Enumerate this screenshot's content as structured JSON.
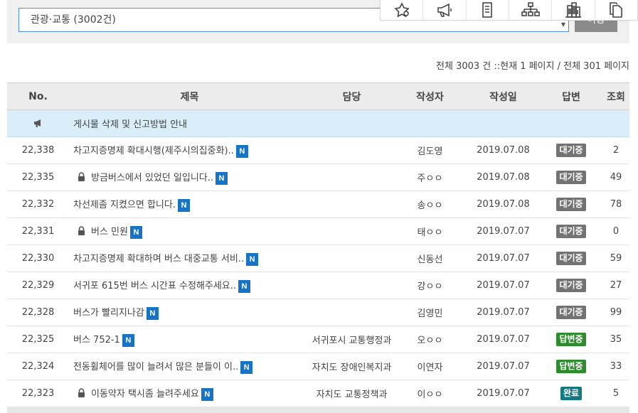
{
  "search": {
    "category_selected": "관광·교통 (3002건)",
    "move_label": "이동"
  },
  "quick_icons": [
    "star-badge-icon",
    "megaphone-icon",
    "document-icon",
    "org-chart-icon",
    "building-icon",
    "copy-icon"
  ],
  "page_info": "전체 3003 건 ::현재 1 페이지 / 전체 301 페이지",
  "table": {
    "headers": {
      "no": "No.",
      "title": "제목",
      "dept": "담당",
      "author": "작성자",
      "date": "작성일",
      "answer": "답변",
      "views": "조회"
    },
    "notice": {
      "icon": "megaphone-icon",
      "title": "게시물 삭제 및 신고방법 안내"
    },
    "rows": [
      {
        "no": "22,338",
        "locked": false,
        "title": "차고지증명제 확대시행(제주시의집중화)..",
        "dept": "",
        "author": "김도영",
        "date": "2019.07.08",
        "status": "대기중",
        "views": "2"
      },
      {
        "no": "22,335",
        "locked": true,
        "title": "방금버스에서 있었던 일입니다..",
        "dept": "",
        "author": "주ㅇㅇ",
        "date": "2019.07.08",
        "status": "대기중",
        "views": "49"
      },
      {
        "no": "22,332",
        "locked": false,
        "title": "차선제좀 지켰으면 합니다.",
        "dept": "",
        "author": "송ㅇㅇ",
        "date": "2019.07.08",
        "status": "대기중",
        "views": "78"
      },
      {
        "no": "22,331",
        "locked": true,
        "title": "버스 민원",
        "dept": "",
        "author": "태ㅇㅇ",
        "date": "2019.07.07",
        "status": "대기중",
        "views": "0"
      },
      {
        "no": "22,330",
        "locked": false,
        "title": "차고지증명제 확대하며 버스 대중교통 서비..",
        "dept": "",
        "author": "신동선",
        "date": "2019.07.07",
        "status": "대기중",
        "views": "59"
      },
      {
        "no": "22,329",
        "locked": false,
        "title": "서귀포 615번 버스 시간표 수정해주세요..",
        "dept": "",
        "author": "강ㅇㅇ",
        "date": "2019.07.07",
        "status": "대기중",
        "views": "27"
      },
      {
        "no": "22,328",
        "locked": false,
        "title": "버스가 빨리지나감",
        "dept": "",
        "author": "김영민",
        "date": "2019.07.07",
        "status": "대기중",
        "views": "99"
      },
      {
        "no": "22,325",
        "locked": false,
        "title": "버스 752-1",
        "dept": "서귀포시 교통행정과",
        "author": "오ㅇㅇ",
        "date": "2019.07.07",
        "status": "답변중",
        "views": "35"
      },
      {
        "no": "22,324",
        "locked": false,
        "title": "전동휠체어를 많이 늘려서 많은 분들이 이..",
        "dept": "자치도 장애인복지과",
        "author": "이연자",
        "date": "2019.07.07",
        "status": "답변중",
        "views": "33"
      },
      {
        "no": "22,323",
        "locked": true,
        "title": "이동약자 택시좀 늘려주세요",
        "dept": "자치도 교통정책과",
        "author": "이ㅇㅇ",
        "date": "2019.07.07",
        "status": "완료",
        "views": "5"
      }
    ],
    "new_badge": "N"
  },
  "colors": {
    "accent_blue": "#1973c4",
    "status_wait": "#737373",
    "status_progress": "#2e8b2e",
    "status_done": "#157a80",
    "notice_bg": "#d9eef8"
  }
}
